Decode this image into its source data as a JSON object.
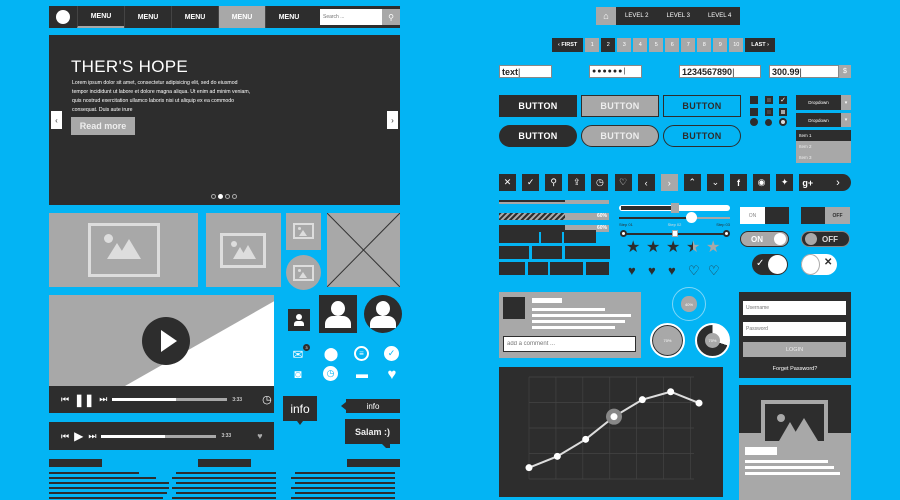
{
  "navbar": {
    "menu_items": [
      "MENU",
      "MENU",
      "MENU",
      "MENU",
      "MENU"
    ],
    "active_index": 3,
    "search_placeholder": "Search ...",
    "search_icon": "search-icon"
  },
  "hero": {
    "title": "THER'S HOPE",
    "body": "Lorem ipsum dolor sit amet, consectetur adipisicing elit, sed do eiusmod tempor incididunt ut labore et dolore magna aliqua. Ut enim ad minim veniam, quis nostrud exercitation ullamco laboris nisi ut aliquip ex ea commodo consequat. Duis aute irure",
    "button": "Read more",
    "prev_icon": "‹",
    "next_icon": "›",
    "slide_count": 4,
    "active_slide": 2
  },
  "video_player": {
    "time": "3:33",
    "progress": 0.55
  },
  "audio_player": {
    "time": "3:33",
    "progress": 0.55
  },
  "tooltips": {
    "info_box": "info",
    "info_tag": "info",
    "chat": "Salam :)"
  },
  "mail_badge": "3",
  "breadcrumb": {
    "home_icon": "home-icon",
    "levels": [
      "LEVEL 2",
      "LEVEL 3",
      "LEVEL 4"
    ]
  },
  "pagination": {
    "first": "‹ FIRST",
    "last": "LAST ›",
    "pages": [
      "1",
      "2",
      "3",
      "4",
      "5",
      "6",
      "7",
      "8",
      "9",
      "10"
    ],
    "active_page": "2"
  },
  "inputs": {
    "text": "text",
    "password": "●●●●●●",
    "number": "1234567890",
    "currency": "300.99",
    "currency_symbol": "$"
  },
  "buttons": {
    "label": "BUTTON"
  },
  "dropdowns": {
    "first": "Dropdown",
    "second": "Dropdown",
    "items": [
      "Item 1",
      "Item 2",
      "Item 3"
    ],
    "selected_item": "Item 1"
  },
  "icon_buttons": [
    "close-icon",
    "check-icon",
    "search-icon",
    "share-icon",
    "clock-icon",
    "heart-icon",
    "chevron-left-icon",
    "chevron-right-icon",
    "chevron-up-icon",
    "chevron-down-icon",
    "facebook-icon",
    "rss-icon",
    "twitter-icon",
    "google-plus-icon"
  ],
  "icon_glyphs": [
    "✕",
    "✓",
    "⚲",
    "⇪",
    "◷",
    "♡",
    "‹",
    "›",
    "⌃",
    "⌄",
    "f",
    "◉",
    "✦",
    "g+"
  ],
  "progress_bars": [
    {
      "value": 0.6,
      "label": ""
    },
    {
      "value": 0.6,
      "label": "60%"
    },
    {
      "value": 0.6,
      "label": "60%"
    }
  ],
  "sliders": {
    "slider1": 0.5,
    "slider2": 0.65,
    "steps": [
      "Step 01",
      "Step 02",
      "Step 03"
    ],
    "current_step": 2
  },
  "rating": {
    "value": 3.5,
    "max": 5
  },
  "hearts": {
    "filled": 2,
    "partial": 1,
    "total": 5
  },
  "toggles": {
    "on_label": "ON",
    "off_label": "OFF"
  },
  "comment": {
    "placeholder": "add a comment ..."
  },
  "circular_progress": [
    {
      "label": "40%",
      "value": 0.4
    },
    {
      "label": "70%",
      "value": 0.7
    },
    {
      "label": "70%",
      "value": 0.7
    }
  ],
  "login": {
    "username_placeholder": "Username",
    "password_placeholder": "Password",
    "button": "LOGIN",
    "forgot": "Forget Password?"
  },
  "chart_data": {
    "type": "line",
    "title": "",
    "xlabel": "",
    "ylabel": "",
    "x": [
      1,
      2,
      3,
      4,
      5,
      6,
      7
    ],
    "values": [
      1.0,
      2.0,
      3.5,
      5.5,
      7.0,
      7.7,
      6.7
    ],
    "highlighted_index": 3,
    "ylim": [
      0,
      9
    ],
    "grid": true
  }
}
